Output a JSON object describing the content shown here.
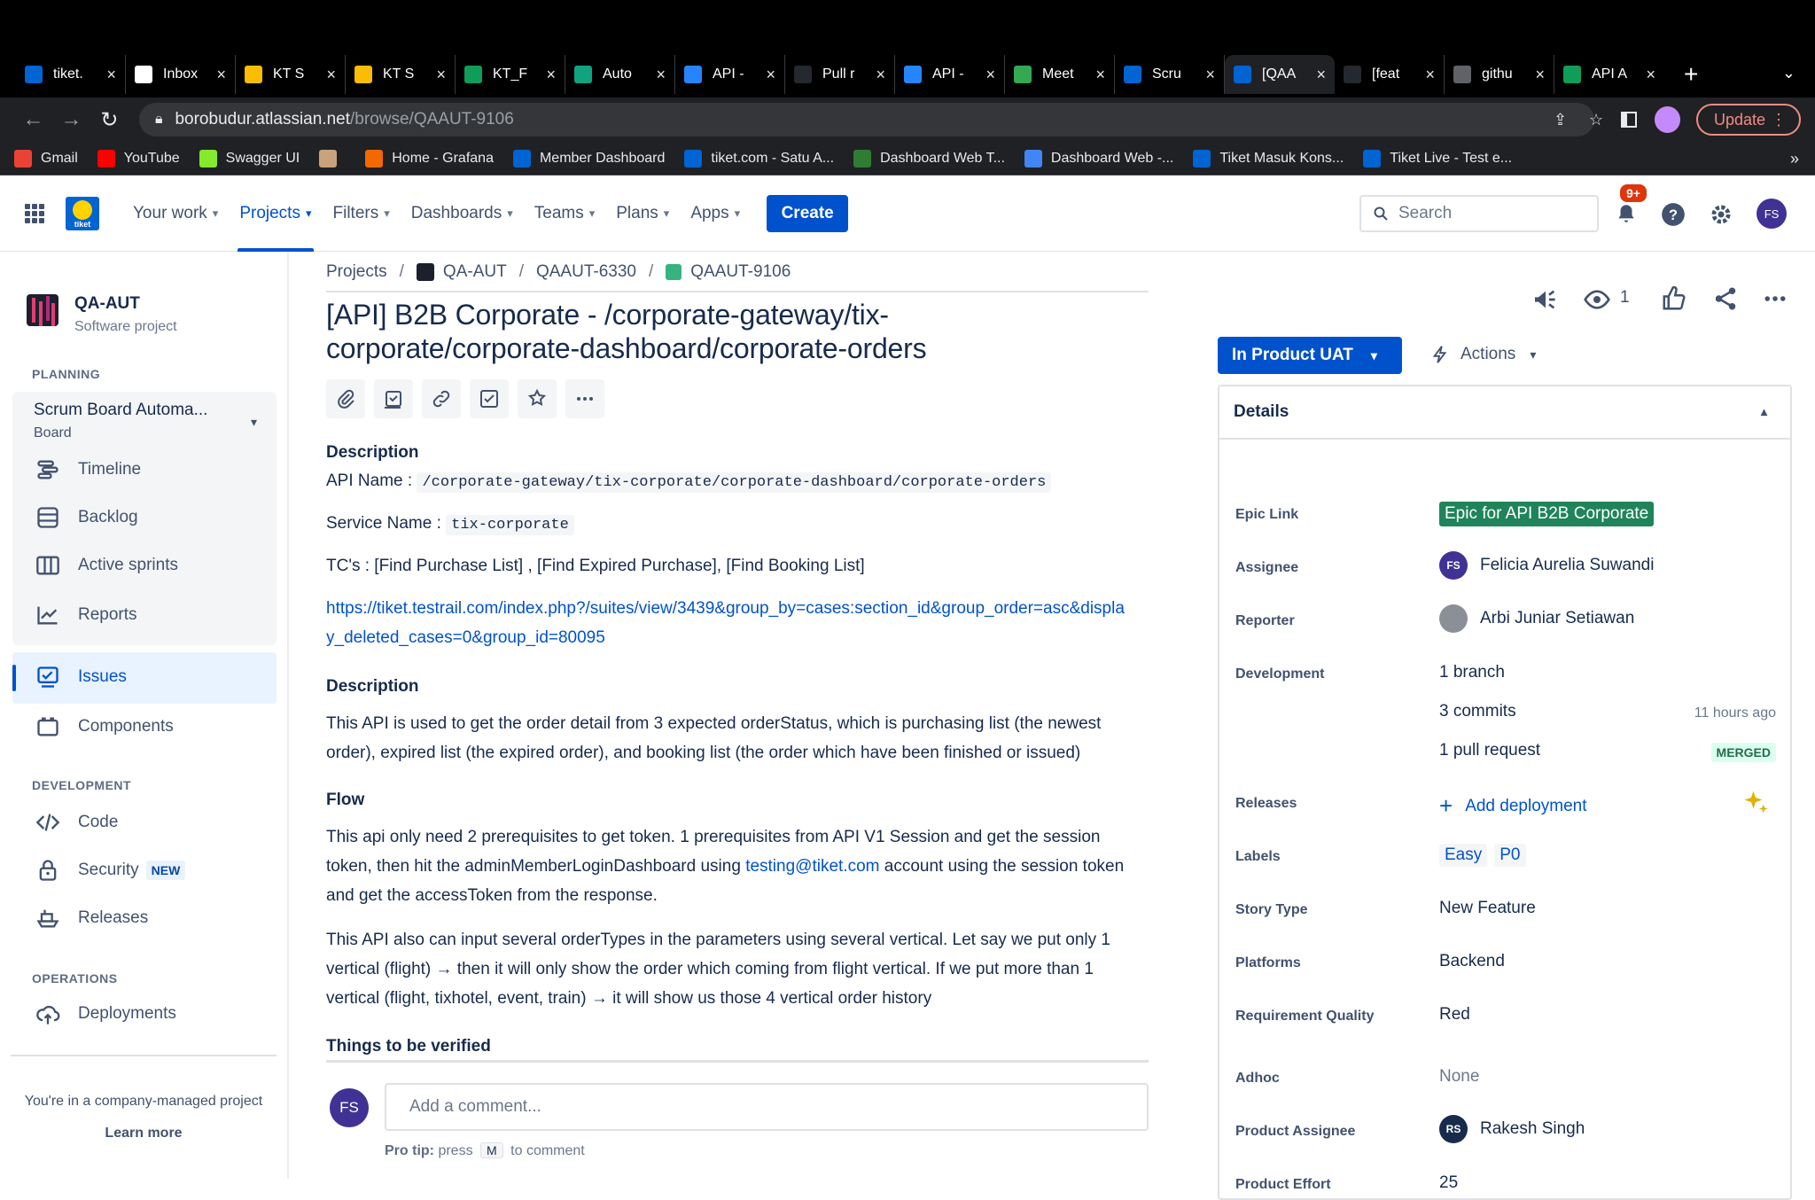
{
  "browser": {
    "tabs": [
      {
        "title": "tiket.",
        "fav_color": "#0064d2",
        "icon": "tiket-favicon"
      },
      {
        "title": "Inbox",
        "fav_color": "#ffffff",
        "icon": "gmail-favicon"
      },
      {
        "title": "KT S",
        "fav_color": "#fbbc04",
        "icon": "slides-favicon"
      },
      {
        "title": "KT S",
        "fav_color": "#fbbc04",
        "icon": "slides-favicon"
      },
      {
        "title": "KT_F",
        "fav_color": "#0f9d58",
        "icon": "sheets-favicon"
      },
      {
        "title": "Auto",
        "fav_color": "#10a37f",
        "icon": "chatgpt-favicon"
      },
      {
        "title": "API -",
        "fav_color": "#2684ff",
        "icon": "confluence-favicon"
      },
      {
        "title": "Pull r",
        "fav_color": "#24292f",
        "icon": "github-favicon"
      },
      {
        "title": "API -",
        "fav_color": "#2684ff",
        "icon": "confluence-favicon"
      },
      {
        "title": "Meet",
        "fav_color": "#34a853",
        "icon": "drive-favicon"
      },
      {
        "title": "Scru",
        "fav_color": "#0064d2",
        "icon": "tiket-favicon"
      },
      {
        "title": "[QAA",
        "fav_color": "#0064d2",
        "icon": "tiket-favicon",
        "active": true
      },
      {
        "title": "[feat",
        "fav_color": "#24292f",
        "icon": "github-favicon"
      },
      {
        "title": "githu",
        "fav_color": "#5f6368",
        "icon": "globe-favicon"
      },
      {
        "title": "API A",
        "fav_color": "#0f9d58",
        "icon": "sheets-favicon"
      }
    ],
    "url_host": "borobudur.atlassian.net",
    "url_path": "/browse/QAAUT-9106",
    "update_label": "Update",
    "bookmarks": [
      {
        "label": "Gmail",
        "color": "#ea4335",
        "icon": "gmail-icon"
      },
      {
        "label": "YouTube",
        "color": "#ff0000",
        "icon": "youtube-icon"
      },
      {
        "label": "Swagger UI",
        "color": "#85ea2d",
        "icon": "swagger-icon"
      },
      {
        "label": "",
        "color": "#c9a27e",
        "icon": "avatar-icon"
      },
      {
        "label": "Home - Grafana",
        "color": "#f46800",
        "icon": "grafana-icon"
      },
      {
        "label": "Member Dashboard",
        "color": "#0064d2",
        "icon": "tiket-icon"
      },
      {
        "label": "tiket.com - Satu A...",
        "color": "#0064d2",
        "icon": "tiket-icon"
      },
      {
        "label": "Dashboard Web T...",
        "color": "#2e7d32",
        "icon": "kibana-icon"
      },
      {
        "label": "Dashboard Web -...",
        "color": "#4285f4",
        "icon": "dashboard-icon"
      },
      {
        "label": "Tiket Masuk Kons...",
        "color": "#0064d2",
        "icon": "tiket-icon"
      },
      {
        "label": "Tiket Live - Test e...",
        "color": "#0064d2",
        "icon": "tiket-icon"
      }
    ]
  },
  "jira": {
    "logo_text": "tiket",
    "nav": [
      {
        "label": "Your work",
        "active": false
      },
      {
        "label": "Projects",
        "active": true
      },
      {
        "label": "Filters",
        "active": false
      },
      {
        "label": "Dashboards",
        "active": false
      },
      {
        "label": "Teams",
        "active": false
      },
      {
        "label": "Plans",
        "active": false
      },
      {
        "label": "Apps",
        "active": false
      }
    ],
    "create_label": "Create",
    "search_placeholder": "Search",
    "notif_badge": "9+",
    "user_initials": "FS"
  },
  "sidebar": {
    "project_name": "QA-AUT",
    "project_type": "Software project",
    "planning_header": "PLANNING",
    "board_name": "Scrum Board Automa...",
    "board_type": "Board",
    "planning_items": [
      "Timeline",
      "Backlog",
      "Active sprints",
      "Reports"
    ],
    "issues_label": "Issues",
    "components_label": "Components",
    "development_header": "DEVELOPMENT",
    "code_label": "Code",
    "security_label": "Security",
    "security_tag": "NEW",
    "releases_label": "Releases",
    "operations_header": "OPERATIONS",
    "deployments_label": "Deployments",
    "footer_text": "You're in a company-managed project",
    "learn_more": "Learn more"
  },
  "issue": {
    "breadcrumbs": [
      "Projects",
      "QA-AUT",
      "QAAUT-6330",
      "QAAUT-9106"
    ],
    "title": "[API] B2B Corporate - /corporate-gateway/tix-corporate/corporate-dashboard/corporate-orders",
    "description_header": "Description",
    "api_name_label": "API Name :",
    "api_name_value": "/corporate-gateway/tix-corporate/corporate-dashboard/corporate-orders",
    "service_name_label": "Service Name :",
    "service_name_value": "tix-corporate",
    "tcs": "TC's : [Find Purchase List] , [Find Expired Purchase], [Find Booking List]",
    "testrail_link": "https://tiket.testrail.com/index.php?/suites/view/3439&group_by=cases:section_id&group_order=asc&display_deleted_cases=0&group_id=80095",
    "description_header_2": "Description",
    "description_text": "This API is used to get the order detail from 3 expected orderStatus, which is purchasing list (the newest order), expired list (the expired order), and booking list (the order which have been finished or issued)",
    "flow_header": "Flow",
    "flow_p1_a": "This api only need 2 prerequisites to get token. 1 prerequisites from API V1 Session and get the session token, then hit the adminMemberLoginDashboard using ",
    "flow_p1_link": "testing@tiket.com",
    "flow_p1_b": " account using the session token and get the accessToken from the response.",
    "flow_p2": "This API also can input several orderTypes in the parameters using several vertical. Let say we put only 1 vertical (flight) → then it will only show the order which coming from flight vertical. If we put more than 1 vertical (flight, tixhotel, event, train) → it will show us those 4 vertical order history",
    "things_header": "Things to be verified",
    "comment_avatar": "FS",
    "comment_placeholder": "Add a comment...",
    "protip_label": "Pro tip:",
    "protip_press": "press",
    "protip_key": "M",
    "protip_rest": "to comment"
  },
  "details": {
    "watch_count": "1",
    "status": "In Product UAT",
    "actions_label": "Actions",
    "header": "Details",
    "epic_link_label": "Epic Link",
    "epic_link_value": "Epic for API B2B Corporate",
    "assignee_label": "Assignee",
    "assignee_initials": "FS",
    "assignee_value": "Felicia Aurelia Suwandi",
    "reporter_label": "Reporter",
    "reporter_value": "Arbi Juniar Setiawan",
    "development_label": "Development",
    "dev_branch": "1 branch",
    "dev_commits": "3 commits",
    "dev_commits_time": "11 hours ago",
    "dev_pr": "1 pull request",
    "dev_pr_status": "MERGED",
    "releases_label": "Releases",
    "releases_action": "Add deployment",
    "labels_label": "Labels",
    "labels": [
      "Easy",
      "P0"
    ],
    "story_type_label": "Story Type",
    "story_type_value": "New Feature",
    "platforms_label": "Platforms",
    "platforms_value": "Backend",
    "req_quality_label": "Requirement Quality",
    "req_quality_value": "Red",
    "adhoc_label": "Adhoc",
    "adhoc_value": "None",
    "product_assignee_label": "Product Assignee",
    "product_assignee_initials": "RS",
    "product_assignee_value": "Rakesh Singh",
    "product_effort_label": "Product Effort",
    "product_effort_value": "25"
  },
  "colors": {
    "jira_blue": "#0052cc",
    "epic_green": "#1f845a",
    "badge_red": "#de350b"
  }
}
